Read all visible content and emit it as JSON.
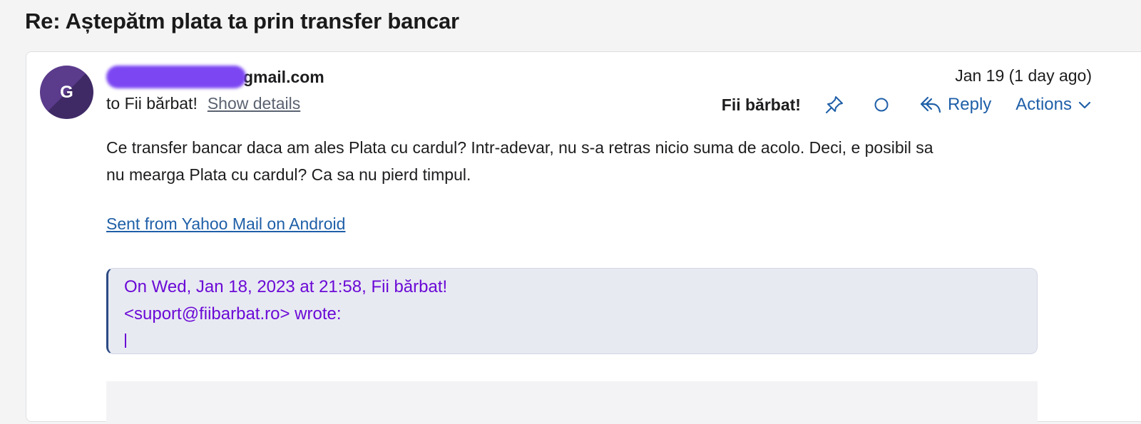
{
  "subject": "Re: Aștepătm plata ta prin transfer bancar",
  "message": {
    "avatar_letter": "G",
    "sender_suffix": "gmail.com",
    "date": "Jan 19 (1 day ago)",
    "to_text": "to Fii bărbat!",
    "show_details": "Show details",
    "sender_name": "Fii bărbat!",
    "reply_label": "Reply",
    "actions_label": "Actions",
    "body_line1": "Ce transfer bancar daca am ales Plata cu cardul? Intr-adevar, nu s-a retras nicio suma de acolo. Deci, e posibil sa",
    "body_line2": "nu mearga Plata cu cardul? Ca sa nu pierd timpul.",
    "signature": "Sent from Yahoo Mail on Android",
    "quote_line1": "On Wed, Jan 18, 2023 at 21:58, Fii bărbat!",
    "quote_line2": "<suport@fiibarbat.ro> wrote:"
  },
  "colors": {
    "link": "#1f5fa8",
    "quote_text": "#6b0ad6",
    "redaction": "#7c46f2",
    "avatar": "#5b3b8c"
  },
  "icons": [
    "pin-icon",
    "circle-icon",
    "reply-icon",
    "chevron-down-icon"
  ]
}
